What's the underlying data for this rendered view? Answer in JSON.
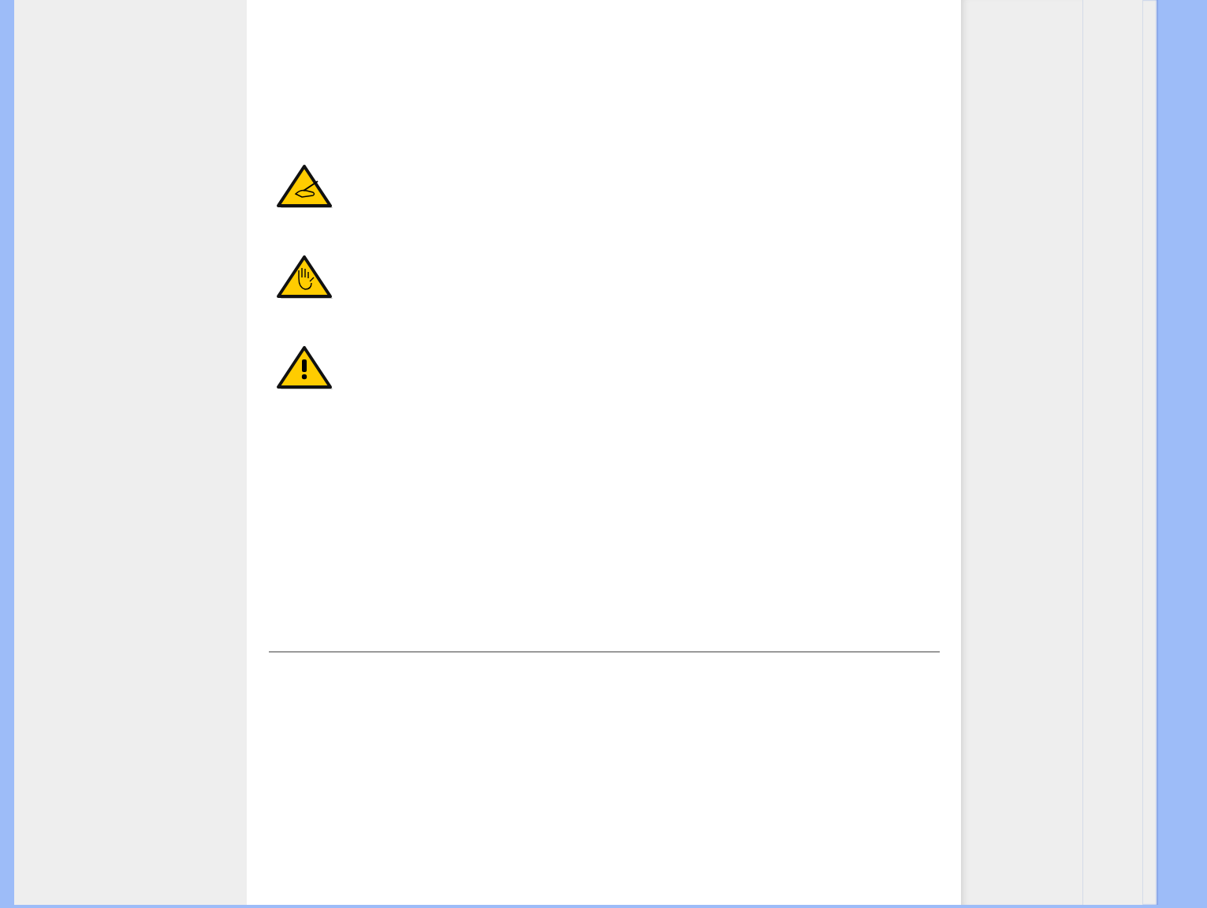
{
  "notices": [
    {
      "kind": "note"
    },
    {
      "kind": "caution"
    },
    {
      "kind": "warning"
    }
  ],
  "divider": {
    "shown": true
  }
}
